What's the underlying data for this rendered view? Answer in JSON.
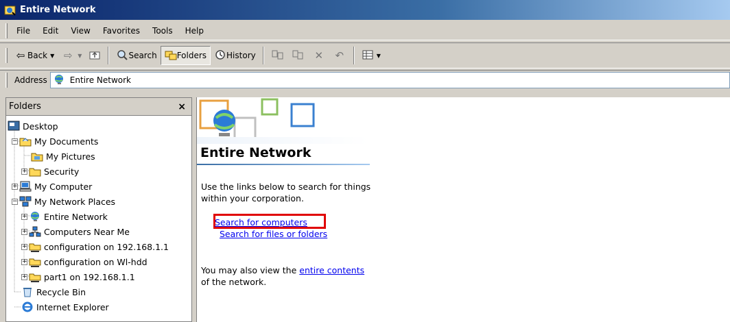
{
  "window": {
    "title": "Entire Network"
  },
  "menu": [
    "File",
    "Edit",
    "View",
    "Favorites",
    "Tools",
    "Help"
  ],
  "toolbar": {
    "back_label": "Back",
    "search_label": "Search",
    "folders_label": "Folders",
    "history_label": "History"
  },
  "address": {
    "label": "Address",
    "value": "Entire Network"
  },
  "folders_pane": {
    "title": "Folders",
    "close": "×",
    "items": [
      {
        "label": "Desktop"
      },
      {
        "label": "My Documents"
      },
      {
        "label": "My Pictures"
      },
      {
        "label": "Security"
      },
      {
        "label": "My Computer"
      },
      {
        "label": "My Network Places"
      },
      {
        "label": "Entire Network"
      },
      {
        "label": "Computers Near Me"
      },
      {
        "label": "configuration on 192.168.1.1"
      },
      {
        "label": "configuration on Wl-hdd"
      },
      {
        "label": "part1 on 192.168.1.1"
      },
      {
        "label": "Recycle Bin"
      },
      {
        "label": "Internet Explorer"
      }
    ]
  },
  "content": {
    "title": "Entire Network",
    "description": "Use the links below to search for things within your corporation.",
    "link_search_computers": "Search for computers",
    "link_search_files": "Search for files or folders",
    "also_prefix": "You may also view the ",
    "also_link": "entire contents",
    "also_suffix": " of the network."
  },
  "colors": {
    "highlight": "#e00000",
    "link": "#0000ee",
    "titlebar": "#0a246a"
  }
}
